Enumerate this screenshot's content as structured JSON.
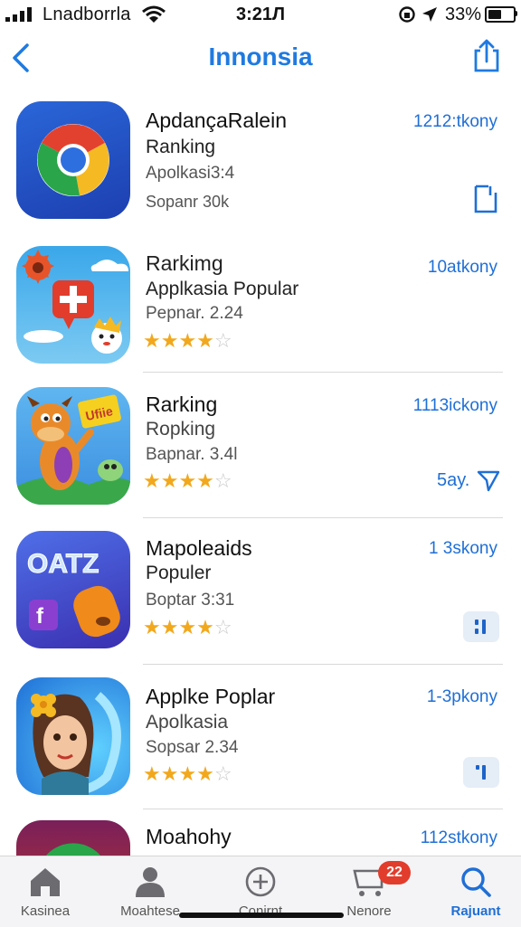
{
  "status_bar": {
    "carrier": "Lnadborrla",
    "time": "3:21Л",
    "battery_pct": "33%"
  },
  "nav": {
    "title": "Innonsia",
    "back_icon": "chevron-left-icon",
    "share_icon": "share-icon"
  },
  "apps": [
    {
      "name": "ApdançaRalein",
      "line2": "Ranking",
      "line3": "Apolkasi3:4",
      "line4": "Sopanr 30k",
      "count": "1212:tkony",
      "rating": 0,
      "action": "bookmark-icon"
    },
    {
      "name": "Rarkimg",
      "line2": "Applkasia Popular",
      "line3": "Pepnar. 2.24",
      "line4": "",
      "count": "10atkony",
      "rating": 4,
      "action": ""
    },
    {
      "name": "Rarking",
      "line2": "Ropking",
      "line3": "Bapnar. 3.4l",
      "line4": "",
      "count": "1113ickony",
      "rating": 4,
      "action": "send-icon",
      "action_label": "5ay."
    },
    {
      "name": "Mapoleaids",
      "line2": "Populer",
      "line3": "Boptar 3:31",
      "line4": "",
      "count": "1 3skony",
      "rating": 4,
      "action": "grid-button"
    },
    {
      "name": "Applke Poplar",
      "line2": "Apolkasia",
      "line3": "Sopsar 2.34",
      "line4": "",
      "count": "1-3pkony",
      "rating": 4,
      "action": "grid-button"
    },
    {
      "name": "Moahohy",
      "line2": "",
      "line3": "",
      "line4": "",
      "count": "112stkony",
      "rating": 0,
      "action": ""
    }
  ],
  "icon_text": {
    "app4_logo": "OATZ",
    "app4_f": "f",
    "app3_sign": "Ufiie"
  },
  "tabs": [
    {
      "label": "Kasinea",
      "icon": "home-icon"
    },
    {
      "label": "Moahtese",
      "icon": "person-icon"
    },
    {
      "label": "Conirnt",
      "icon": "plus-circle-icon"
    },
    {
      "label": "Nenore",
      "icon": "cart-icon",
      "badge": "22"
    },
    {
      "label": "Rajuant",
      "icon": "search-icon",
      "active": true
    }
  ],
  "colors": {
    "accent": "#1f7ae0",
    "star": "#f2a81d",
    "badge": "#e23c2c"
  }
}
